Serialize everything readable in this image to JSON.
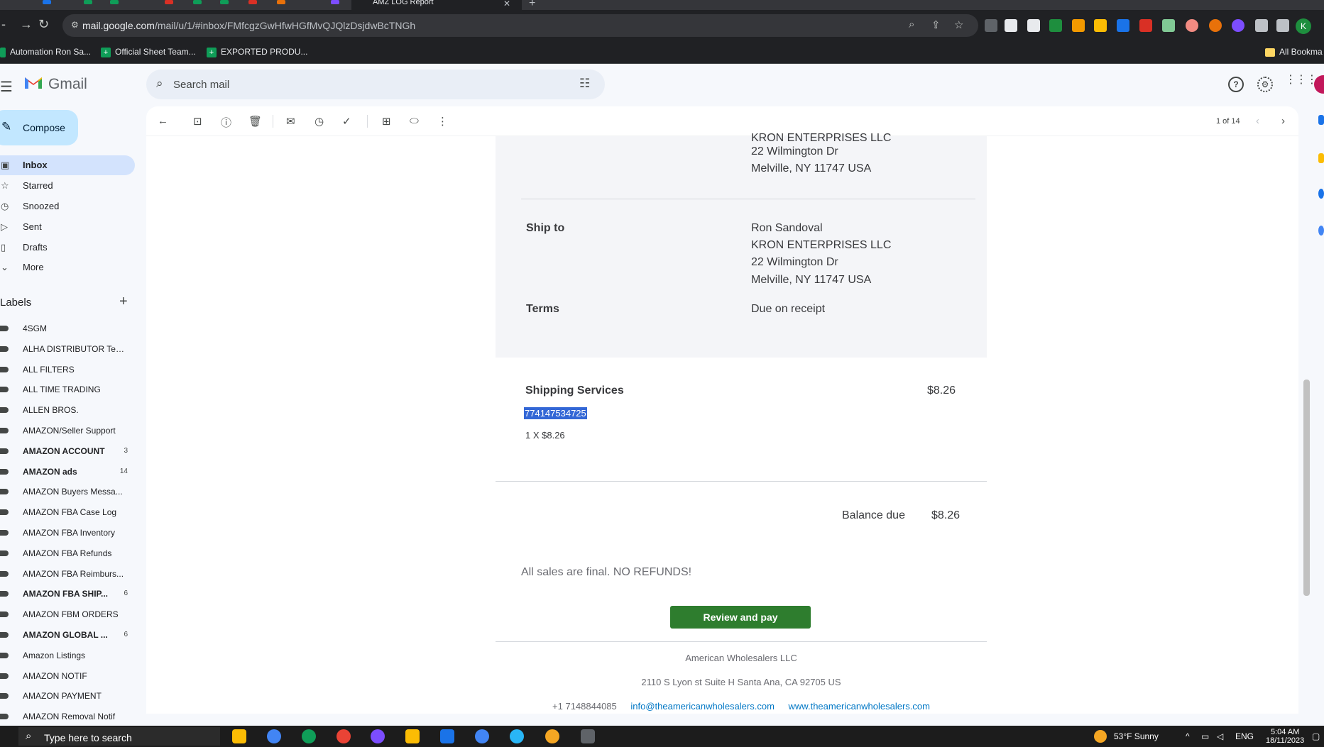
{
  "browser": {
    "active_tab_title": "AMZ LOG Report",
    "url_host": "mail.google.com",
    "url_path": "/mail/u/1/#inbox/FMfcgzGwHfwHGfMvQJQlzDsjdwBcTNGh",
    "bookmarks": [
      "Automation Ron Sa...",
      "Official Sheet Team...",
      "EXPORTED PRODU...",
      "All Bookma"
    ],
    "profile_initial": "K"
  },
  "gmail": {
    "brand": "Gmail",
    "search_placeholder": "Search mail",
    "compose_label": "Compose",
    "nav": [
      {
        "label": "Inbox",
        "icon": "inbox-icon",
        "active": true
      },
      {
        "label": "Starred",
        "icon": "star-icon"
      },
      {
        "label": "Snoozed",
        "icon": "clock-icon"
      },
      {
        "label": "Sent",
        "icon": "send-icon"
      },
      {
        "label": "Drafts",
        "icon": "draft-icon"
      },
      {
        "label": "More",
        "icon": "chevron-down-icon"
      }
    ],
    "labels_heading": "Labels",
    "labels": [
      {
        "name": "4SGM",
        "bold": false,
        "count": ""
      },
      {
        "name": "ALHA DISTRIBUTOR Tea...",
        "bold": false,
        "count": ""
      },
      {
        "name": "ALL FILTERS",
        "bold": false,
        "count": ""
      },
      {
        "name": "ALL TIME TRADING",
        "bold": false,
        "count": ""
      },
      {
        "name": "ALLEN BROS.",
        "bold": false,
        "count": ""
      },
      {
        "name": "AMAZON/Seller Support",
        "bold": false,
        "count": ""
      },
      {
        "name": "AMAZON ACCOUNT",
        "bold": true,
        "count": "3"
      },
      {
        "name": "AMAZON ads",
        "bold": true,
        "count": "14"
      },
      {
        "name": "AMAZON Buyers Messa...",
        "bold": false,
        "count": ""
      },
      {
        "name": "AMAZON FBA Case Log",
        "bold": false,
        "count": ""
      },
      {
        "name": "AMAZON FBA Inventory",
        "bold": false,
        "count": ""
      },
      {
        "name": "AMAZON FBA Refunds",
        "bold": false,
        "count": ""
      },
      {
        "name": "AMAZON FBA Reimburs...",
        "bold": false,
        "count": ""
      },
      {
        "name": "AMAZON FBA SHIP...",
        "bold": true,
        "count": "6"
      },
      {
        "name": "AMAZON FBM ORDERS",
        "bold": false,
        "count": ""
      },
      {
        "name": "AMAZON GLOBAL ...",
        "bold": true,
        "count": "6"
      },
      {
        "name": "Amazon Listings",
        "bold": false,
        "count": ""
      },
      {
        "name": "AMAZON NOTIF",
        "bold": false,
        "count": ""
      },
      {
        "name": "AMAZON PAYMENT",
        "bold": false,
        "count": ""
      },
      {
        "name": "AMAZON Removal Notif",
        "bold": false,
        "count": ""
      }
    ],
    "pager": "1 of 14"
  },
  "invoice": {
    "bill_to_lines": [
      "KRON ENTERPRISES LLC",
      "22 Wilmington Dr",
      "Melville, NY 11747 USA"
    ],
    "ship_to_label": "Ship to",
    "ship_to_lines": [
      "Ron Sandoval",
      "KRON ENTERPRISES LLC",
      "22 Wilmington Dr",
      "Melville, NY 11747 USA"
    ],
    "terms_label": "Terms",
    "terms_value": "Due on receipt",
    "item_name": "Shipping Services",
    "item_amount": "$8.26",
    "tracking_number": "774147534725",
    "item_qty": "1 X $8.26",
    "balance_label": "Balance due",
    "balance_amount": "$8.26",
    "note": "All sales are final. NO REFUNDS!",
    "pay_button": "Review and pay",
    "footer_company": "American Wholesalers LLC",
    "footer_address": "2110 S Lyon st Suite H Santa Ana, CA 92705 US",
    "footer_phone": "+1 7148844085",
    "footer_email": "info@theamericanwholesalers.com",
    "footer_web": "www.theamericanwholesalers.com"
  },
  "taskbar": {
    "search_placeholder": "Type here to search",
    "weather": "53°F  Sunny",
    "language": "ENG",
    "time": "5:04 AM",
    "date": "18/11/2023"
  },
  "colors": {
    "accent_blue": "#c2e7ff",
    "inbox_active": "#d3e3fd",
    "pay_button": "#2e7d2e",
    "selection": "#3367d6"
  }
}
